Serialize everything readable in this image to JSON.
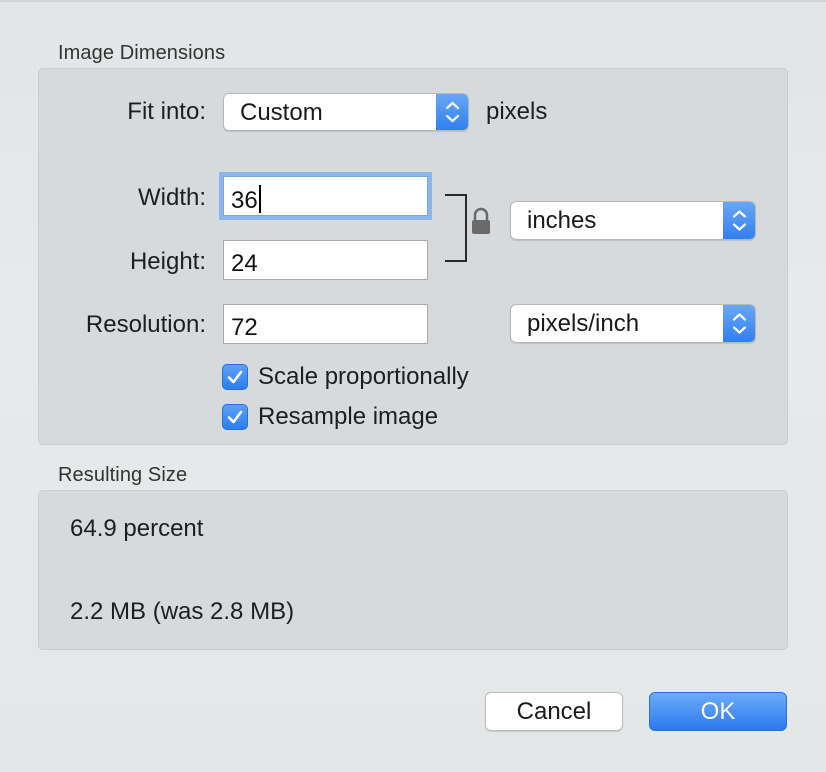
{
  "image_dimensions": {
    "section_title": "Image Dimensions",
    "fit_into": {
      "label": "Fit into:",
      "selected": "Custom",
      "suffix": "pixels"
    },
    "width": {
      "label": "Width:",
      "value": "36"
    },
    "height": {
      "label": "Height:",
      "value": "24"
    },
    "size_units": {
      "selected": "inches"
    },
    "resolution": {
      "label": "Resolution:",
      "value": "72",
      "units_selected": "pixels/inch"
    },
    "scale_proportionally": {
      "label": "Scale proportionally",
      "checked": true
    },
    "resample_image": {
      "label": "Resample image",
      "checked": true
    }
  },
  "resulting_size": {
    "section_title": "Resulting Size",
    "percent": "64.9 percent",
    "file_size": "2.2 MB (was 2.8 MB)"
  },
  "buttons": {
    "cancel_label": "Cancel",
    "ok_label": "OK"
  },
  "icons": {
    "lock": "lock-icon",
    "popup_stepper": "chevron-up-down-icon",
    "checkmark": "checkmark-icon"
  },
  "colors": {
    "accent_blue": "#2f7ef0",
    "focus_ring": "#8bb6ee",
    "group_background": "#d6dadc"
  }
}
